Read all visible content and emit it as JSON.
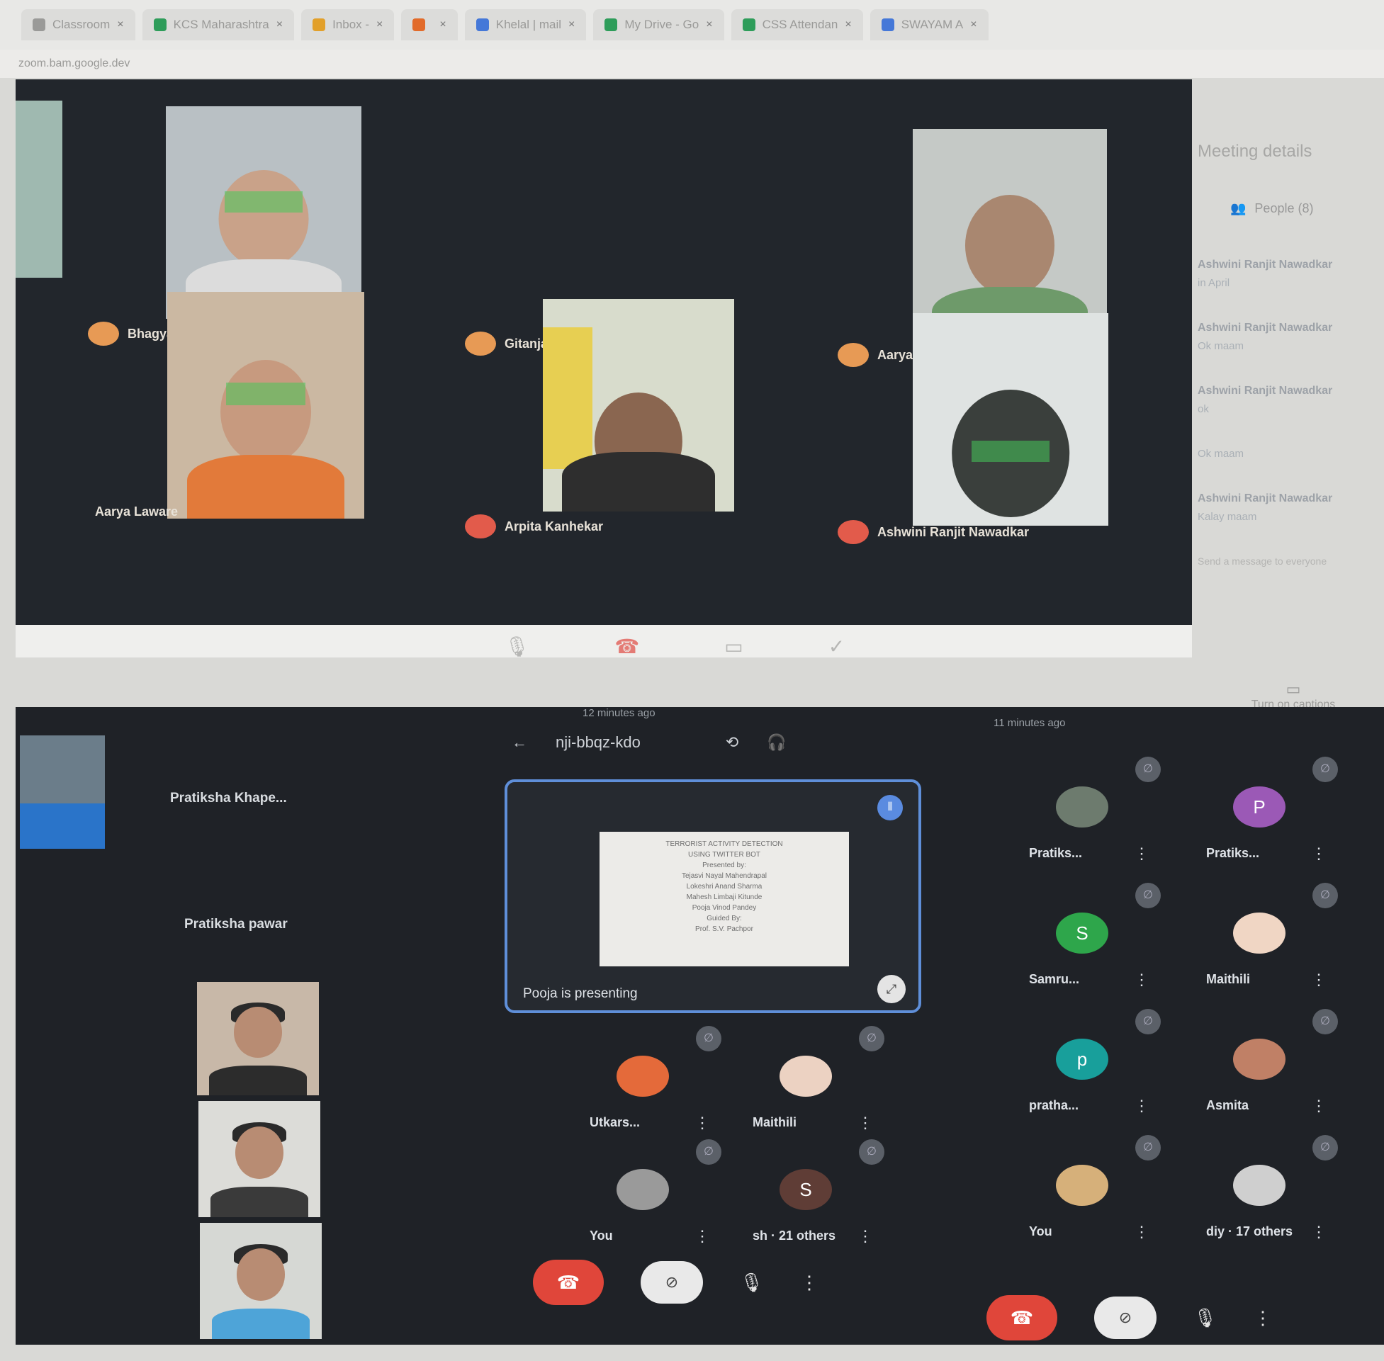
{
  "browser": {
    "tabs": [
      {
        "label": "Classroom",
        "color": "#9a9a98"
      },
      {
        "label": "KCS Maharashtra",
        "color": "#2e9d5a"
      },
      {
        "label": "Inbox - ",
        "color": "#e2a02a"
      },
      {
        "label": "",
        "color": "#e26b2a"
      },
      {
        "label": "Khelal | mail",
        "color": "#4578d8"
      },
      {
        "label": "My Drive - Go",
        "color": "#2e9d5a"
      },
      {
        "label": "CSS Attendan",
        "color": "#2e9d5a"
      },
      {
        "label": "SWAYAM A",
        "color": "#4578d8"
      }
    ],
    "url": "zoom.bam.google.dev"
  },
  "meeting_top": {
    "participants": [
      {
        "name": "Bhagyashree",
        "avatar": "orange"
      },
      {
        "name": "Gitanjali Patil",
        "avatar": "orange"
      },
      {
        "name": "Aarya Rahul Kamble",
        "avatar": "orange"
      },
      {
        "name": "Aarya Laware",
        "avatar": "none"
      },
      {
        "name": "Arpita Kanhekar",
        "avatar": "red"
      },
      {
        "name": "Ashwini Ranjit Nawadkar",
        "avatar": "red"
      }
    ],
    "controls": {
      "mic": "mic-icon",
      "end": "end-call-icon",
      "camera": "camera-icon",
      "check": "check-icon"
    }
  },
  "side_panel": {
    "title": "Meeting details",
    "people_label": "People (8)",
    "messages": [
      {
        "who": "Ashwini Ranjit Nawadkar",
        "text": "in April"
      },
      {
        "who": "Ashwini Ranjit Nawadkar",
        "text": "Ok maam"
      },
      {
        "who": "Ashwini Ranjit Nawadkar",
        "text": "ok"
      },
      {
        "who": "",
        "text": "Ok maam"
      },
      {
        "who": "Ashwini Ranjit Nawadkar",
        "text": "Kalay maam"
      }
    ],
    "footer_hint": "Send a message to everyone",
    "captions_label": "Turn on captions"
  },
  "phone": {
    "meeting_code": "nji-bbqz-kdo",
    "time_ago": "12 minutes ago",
    "right_time": "11 minutes ago",
    "presenting_label": "Pooja is presenting",
    "slide_lines": [
      "TERRORIST ACTIVITY DETECTION",
      "USING TWITTER BOT",
      "Presented by:",
      "Tejasvi Nayal Mahendrapal",
      "Lokeshri Anand Sharma",
      "Mahesh Limbaji Kitunde",
      "Pooja Vinod Pandey",
      "Guided By:",
      "Prof. S.V. Pachpor"
    ],
    "left_list": [
      {
        "name": "Pratiksha Khape..."
      },
      {
        "name": "Pratiksha pawar"
      }
    ],
    "grid_participants": [
      {
        "name": "Utkars...",
        "color": "#e46a3a",
        "letter": ""
      },
      {
        "name": "Maithili",
        "color": "#ecd2c2",
        "letter": ""
      },
      {
        "name": "You",
        "color": "#9a9a9a",
        "letter": ""
      },
      {
        "name": "sh · 21 others",
        "color": "#5f3d36",
        "letter": "S"
      }
    ],
    "right_participants": [
      {
        "name": "Pratiks...",
        "color": "#6d7b6e",
        "letter": ""
      },
      {
        "name": "Pratiks...",
        "color": "#9b59b6",
        "letter": "P"
      },
      {
        "name": "Samru...",
        "color": "#2ea64b",
        "letter": "S"
      },
      {
        "name": "Maithili",
        "color": "#f0d6c4",
        "letter": ""
      },
      {
        "name": "pratha...",
        "color": "#189f9b",
        "letter": "p"
      },
      {
        "name": "Asmita",
        "color": "#c08066",
        "letter": ""
      },
      {
        "name": "You",
        "color": "#d6b07a",
        "letter": ""
      },
      {
        "name": "diy · 17 others",
        "color": "#cfcfcf",
        "letter": ""
      }
    ]
  },
  "colors": {
    "accent_blue": "#5f8fd9",
    "end_red": "#e0463a"
  }
}
